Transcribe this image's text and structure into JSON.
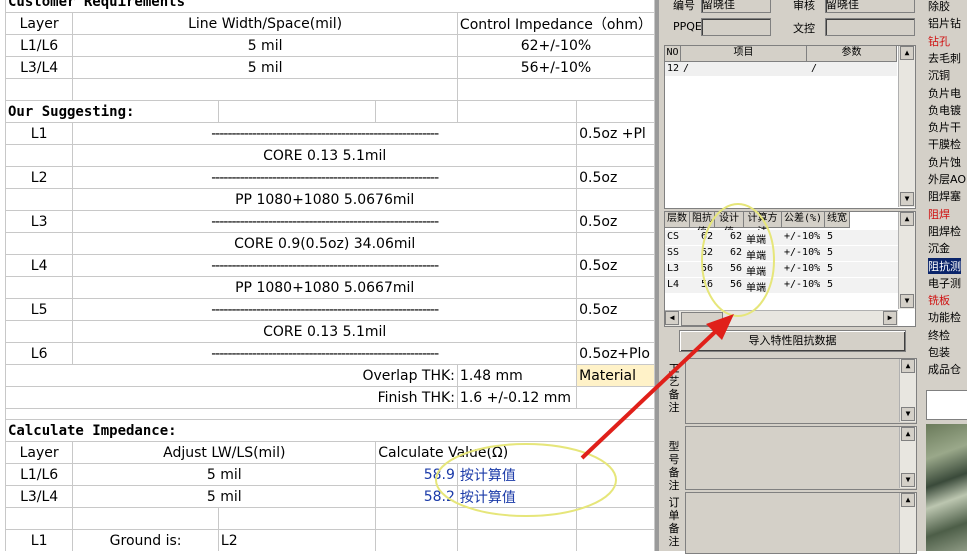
{
  "doc": {
    "title_req": "Customer Requirements",
    "req_header": [
      "Layer",
      "Line Width/Space(mil)",
      "Control Impedance（ohm）"
    ],
    "req_rows": [
      [
        "L1/L6",
        "5 mil",
        "62+/-10%"
      ],
      [
        "L3/L4",
        "5 mil",
        "56+/-10%"
      ]
    ],
    "suggest_title": "Our Suggesting:",
    "stack": [
      {
        "layer": "L1",
        "mid": "--------------------------------------------------------",
        "right": "0.5oz +Pl"
      },
      {
        "layer": "",
        "mid": "CORE  0.13  5.1mil",
        "right": ""
      },
      {
        "layer": "L2",
        "mid": "--------------------------------------------------------",
        "right": "0.5oz"
      },
      {
        "layer": "",
        "mid": "PP  1080+1080  5.0676mil",
        "right": ""
      },
      {
        "layer": "L3",
        "mid": "--------------------------------------------------------",
        "right": "0.5oz"
      },
      {
        "layer": "",
        "mid": "CORE  0.9(0.5oz)  34.06mil",
        "right": ""
      },
      {
        "layer": "L4",
        "mid": "--------------------------------------------------------",
        "right": "0.5oz"
      },
      {
        "layer": "",
        "mid": "PP  1080+1080  5.0667mil",
        "right": ""
      },
      {
        "layer": "L5",
        "mid": "--------------------------------------------------------",
        "right": "0.5oz"
      },
      {
        "layer": "",
        "mid": "CORE  0.13  5.1mil",
        "right": ""
      },
      {
        "layer": "L6",
        "mid": "--------------------------------------------------------",
        "right": "0.5oz+Plo"
      }
    ],
    "overlap_label": "Overlap THK:",
    "overlap_value": "1.48 mm",
    "material_label": "Material",
    "finish_label": "Finish THK:",
    "finish_value": "1.6 +/-0.12 mm",
    "calc_title": "Calculate Impedance:",
    "calc_header": [
      "Layer",
      "Adjust LW/LS(mil)",
      "Calculate Value(Ω)"
    ],
    "calc_rows": [
      [
        "L1/L6",
        "5 mil",
        "58.9",
        "按计算值"
      ],
      [
        "L3/L4",
        "5 mil",
        "58.2",
        "按计算值"
      ]
    ],
    "ground_row": [
      "L1",
      "Ground is:",
      "L2"
    ]
  },
  "panel": {
    "top_fields": [
      {
        "label": "编号",
        "value": "留晓佳"
      },
      {
        "label": "审核",
        "value": "留晓佳"
      },
      {
        "label": "PPQE",
        "value": ""
      },
      {
        "label": "文控",
        "value": ""
      }
    ],
    "items_header": [
      "NO",
      "项目",
      "参数"
    ],
    "items_rows": [
      [
        "12",
        "/",
        "/"
      ]
    ],
    "imp_header": [
      "层数",
      "阻抗值",
      "设计值",
      "计算方法",
      "公差(%)",
      "线宽"
    ],
    "imp_rows": [
      [
        "CS",
        "62",
        "62",
        "单端",
        "+/-10%",
        "5"
      ],
      [
        "SS",
        "62",
        "62",
        "单端",
        "+/-10%",
        "5"
      ],
      [
        "L3",
        "56",
        "56",
        "单端",
        "+/-10%",
        "5"
      ],
      [
        "L4",
        "56",
        "56",
        "单端",
        "+/-10%",
        "5"
      ]
    ],
    "import_button": "导入特性阻抗数据",
    "notes": [
      "工艺备注",
      "型号备注",
      "订单备注"
    ]
  },
  "process": [
    {
      "label": "除胶",
      "color": "#000000"
    },
    {
      "label": "铝片钻",
      "color": "#000000"
    },
    {
      "label": "钻孔",
      "color": "#d01010"
    },
    {
      "label": "去毛刺",
      "color": "#000000"
    },
    {
      "label": "沉铜",
      "color": "#000000"
    },
    {
      "label": "负片电",
      "color": "#000000"
    },
    {
      "label": "负电镀",
      "color": "#000000"
    },
    {
      "label": "负片干",
      "color": "#000000"
    },
    {
      "label": "干膜检",
      "color": "#000000"
    },
    {
      "label": "负片蚀",
      "color": "#000000"
    },
    {
      "label": "外层AO",
      "color": "#000000"
    },
    {
      "label": "阻焊塞",
      "color": "#000000"
    },
    {
      "label": "阻焊",
      "color": "#d01010"
    },
    {
      "label": "阻焊检",
      "color": "#000000"
    },
    {
      "label": "沉金",
      "color": "#000000"
    },
    {
      "label": "阻抗测",
      "color": "#ffffff",
      "selected": true
    },
    {
      "label": "电子测",
      "color": "#000000"
    },
    {
      "label": "铣板",
      "color": "#d01010"
    },
    {
      "label": "功能检",
      "color": "#000000"
    },
    {
      "label": "终检",
      "color": "#000000"
    },
    {
      "label": "包装",
      "color": "#000000"
    },
    {
      "label": "成品仓",
      "color": "#000000"
    }
  ],
  "annotation": {
    "color": "#e0201a",
    "ellipse_color": "#e8e860"
  }
}
